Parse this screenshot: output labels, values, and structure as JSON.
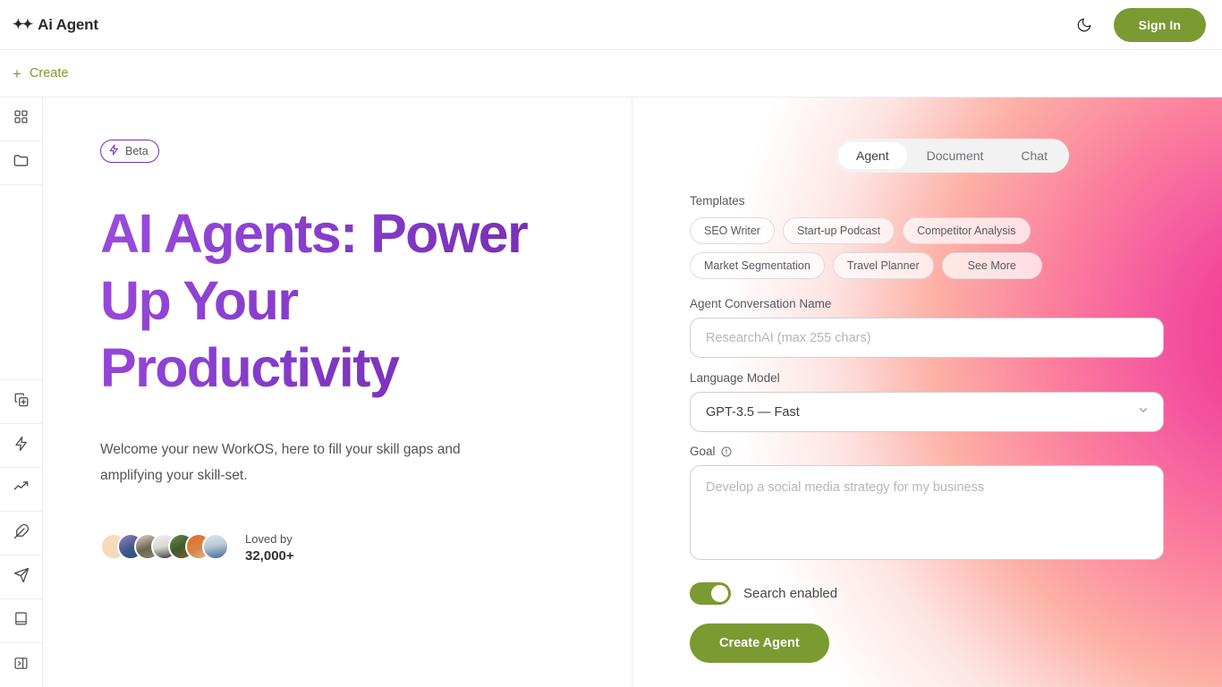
{
  "header": {
    "logo_sparks": "✦✦",
    "brand": "Ai Agent",
    "theme_toggle_icon": "moon-icon",
    "signin_label": "Sign In"
  },
  "createbar": {
    "plus": "+",
    "label": "Create"
  },
  "sidebar": {
    "items": [
      {
        "icon": "grid-dashboard-icon",
        "name": "dashboard"
      },
      {
        "icon": "folder-icon",
        "name": "folder"
      },
      {
        "icon": "copy-plus-icon",
        "name": "new-copy"
      },
      {
        "icon": "lightning-icon",
        "name": "actions"
      },
      {
        "icon": "trending-up-icon",
        "name": "analytics"
      },
      {
        "icon": "feather-icon",
        "name": "write"
      },
      {
        "icon": "send-icon",
        "name": "send"
      },
      {
        "icon": "book-icon",
        "name": "library"
      },
      {
        "icon": "panel-right-icon",
        "name": "collapse-panel"
      }
    ]
  },
  "hero": {
    "badge": {
      "icon": "lightning-icon",
      "label": "Beta"
    },
    "headline": "AI Agents: Power Up Your Productivity",
    "subtitle": "Welcome your new WorkOS, here to fill your skill gaps and amplifying your skill-set.",
    "social_proof": {
      "caption": "Loved by",
      "count": "32,000+",
      "avatar_count": 7
    }
  },
  "panel": {
    "tabs": [
      {
        "label": "Agent",
        "active": true
      },
      {
        "label": "Document",
        "active": false
      },
      {
        "label": "Chat",
        "active": false
      }
    ],
    "templates": {
      "label": "Templates",
      "chips": [
        "SEO Writer",
        "Start-up Podcast",
        "Competitor Analysis",
        "Market Segmentation",
        "Travel Planner",
        "See More"
      ]
    },
    "conversation_name": {
      "label": "Agent Conversation Name",
      "placeholder": "ResearchAI (max 255 chars)",
      "value": ""
    },
    "language_model": {
      "label": "Language Model",
      "selected": "GPT-3.5 — Fast",
      "chevron_icon": "chevron-down-icon"
    },
    "goal": {
      "label": "Goal",
      "info_icon": "info-icon",
      "placeholder": "Develop a social media strategy for my business",
      "value": ""
    },
    "search_toggle": {
      "label": "Search enabled",
      "enabled": true
    },
    "submit_label": "Create Agent"
  },
  "colors": {
    "brand_green": "#7b9a32",
    "headline_purple_light": "#9b4ddb",
    "headline_purple_dark": "#6d28a8",
    "beta_border_purple": "#6f34b0",
    "gradient_magenta": "#ef2d8f",
    "gradient_peach": "#ffc9a8"
  }
}
